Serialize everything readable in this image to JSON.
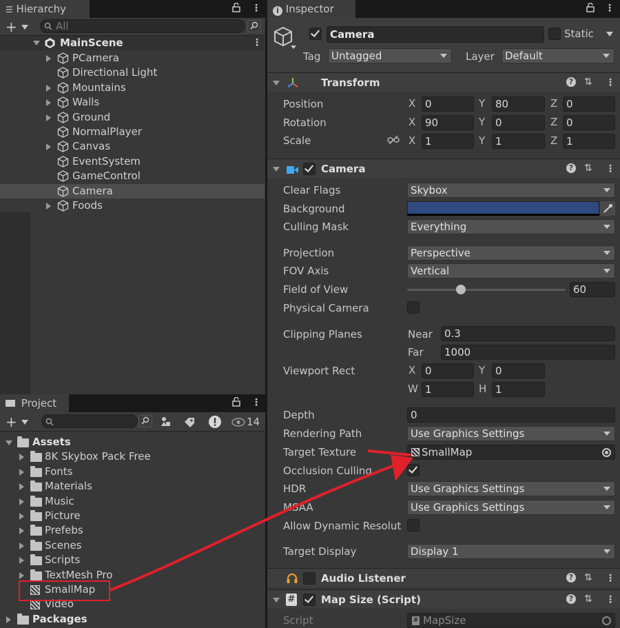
{
  "hierarchy": {
    "tab_label": "Hierarchy",
    "search_placeholder": "All",
    "scene_name": "MainScene",
    "items": [
      {
        "label": "PCamera",
        "expandable": true
      },
      {
        "label": "Directional Light",
        "expandable": false
      },
      {
        "label": "Mountains",
        "expandable": true
      },
      {
        "label": "Walls",
        "expandable": true
      },
      {
        "label": "Ground",
        "expandable": true
      },
      {
        "label": "NormalPlayer",
        "expandable": false
      },
      {
        "label": "Canvas",
        "expandable": true
      },
      {
        "label": "EventSystem",
        "expandable": false
      },
      {
        "label": "GameControl",
        "expandable": false
      },
      {
        "label": "Camera",
        "expandable": false,
        "selected": true
      },
      {
        "label": "Foods",
        "expandable": true
      }
    ]
  },
  "project": {
    "tab_label": "Project",
    "hidden_count": "14",
    "assets_label": "Assets",
    "folders": [
      "8K Skybox Pack Free",
      "Fonts",
      "Materials",
      "Music",
      "Picture",
      "Prefebs",
      "Scenes",
      "Scripts",
      "TextMesh Pro"
    ],
    "files": [
      "SmallMap",
      "Video"
    ],
    "packages_label": "Packages"
  },
  "inspector": {
    "tab_label": "Inspector",
    "object_name": "Camera",
    "static_label": "Static",
    "tag_label": "Tag",
    "tag_value": "Untagged",
    "layer_label": "Layer",
    "layer_value": "Default",
    "transform": {
      "title": "Transform",
      "position_label": "Position",
      "rotation_label": "Rotation",
      "scale_label": "Scale",
      "position": {
        "x": "0",
        "y": "80",
        "z": "0"
      },
      "rotation": {
        "x": "90",
        "y": "0",
        "z": "0"
      },
      "scale": {
        "x": "1",
        "y": "1",
        "z": "1"
      }
    },
    "camera": {
      "title": "Camera",
      "clear_flags_label": "Clear Flags",
      "clear_flags": "Skybox",
      "background_label": "Background",
      "background_color": "#2f4a80",
      "culling_mask_label": "Culling Mask",
      "culling_mask": "Everything",
      "projection_label": "Projection",
      "projection": "Perspective",
      "fov_axis_label": "FOV Axis",
      "fov_axis": "Vertical",
      "fov_label": "Field of View",
      "fov_value": "60",
      "fov_slider_fraction": 0.34,
      "physical_label": "Physical Camera",
      "clipping_label": "Clipping Planes",
      "near_label": "Near",
      "near": "0.3",
      "far_label": "Far",
      "far": "1000",
      "viewport_label": "Viewport Rect",
      "viewport": {
        "x": "0",
        "y": "0",
        "w": "1",
        "h": "1"
      },
      "depth_label": "Depth",
      "depth": "0",
      "rendering_path_label": "Rendering Path",
      "rendering_path": "Use Graphics Settings",
      "target_texture_label": "Target Texture",
      "target_texture": "SmallMap",
      "occlusion_label": "Occlusion Culling",
      "hdr_label": "HDR",
      "hdr": "Use Graphics Settings",
      "msaa_label": "MSAA",
      "msaa": "Use Graphics Settings",
      "dynres_label": "Allow Dynamic Resolut",
      "target_display_label": "Target Display",
      "target_display": "Display 1"
    },
    "audio_listener": {
      "title": "Audio Listener"
    },
    "map_size": {
      "title": "Map Size (Script)",
      "script_label": "Script",
      "script_value": "MapSize"
    }
  },
  "annotation_color": "#e0202a"
}
